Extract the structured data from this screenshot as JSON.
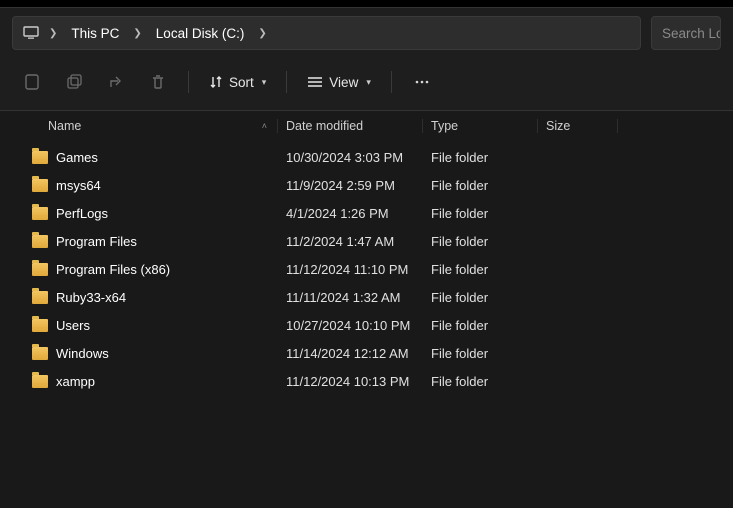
{
  "breadcrumb": {
    "segments": [
      "This PC",
      "Local Disk (C:)"
    ]
  },
  "search": {
    "placeholder": "Search Lo"
  },
  "toolbar": {
    "sort_label": "Sort",
    "view_label": "View"
  },
  "columns": {
    "name": "Name",
    "date": "Date modified",
    "type": "Type",
    "size": "Size"
  },
  "rows": [
    {
      "name": "Games",
      "date": "10/30/2024 3:03 PM",
      "type": "File folder",
      "size": ""
    },
    {
      "name": "msys64",
      "date": "11/9/2024 2:59 PM",
      "type": "File folder",
      "size": ""
    },
    {
      "name": "PerfLogs",
      "date": "4/1/2024 1:26 PM",
      "type": "File folder",
      "size": ""
    },
    {
      "name": "Program Files",
      "date": "11/2/2024 1:47 AM",
      "type": "File folder",
      "size": ""
    },
    {
      "name": "Program Files (x86)",
      "date": "11/12/2024 11:10 PM",
      "type": "File folder",
      "size": ""
    },
    {
      "name": "Ruby33-x64",
      "date": "11/11/2024 1:32 AM",
      "type": "File folder",
      "size": ""
    },
    {
      "name": "Users",
      "date": "10/27/2024 10:10 PM",
      "type": "File folder",
      "size": ""
    },
    {
      "name": "Windows",
      "date": "11/14/2024 12:12 AM",
      "type": "File folder",
      "size": ""
    },
    {
      "name": "xampp",
      "date": "11/12/2024 10:13 PM",
      "type": "File folder",
      "size": ""
    }
  ]
}
